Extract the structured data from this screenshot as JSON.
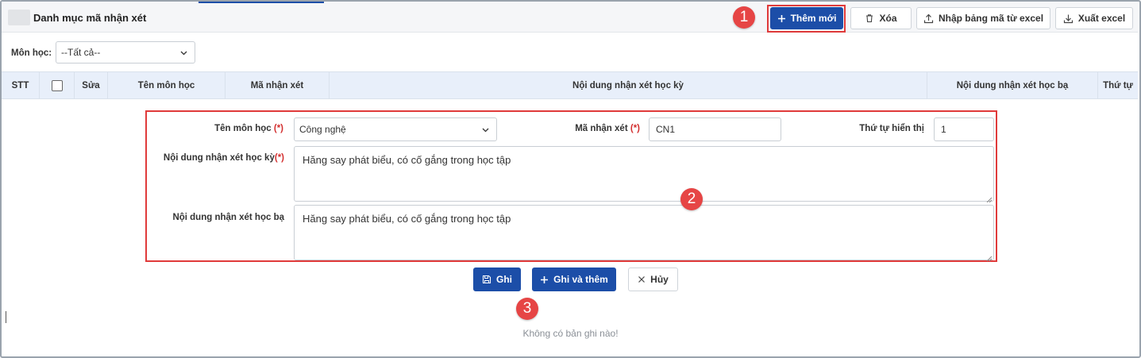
{
  "header": {
    "title": "Danh mục mã nhận xét",
    "buttons": {
      "add": "Thêm mới",
      "delete": "Xóa",
      "import": "Nhập bảng mã từ excel",
      "export": "Xuất excel"
    }
  },
  "filter": {
    "label": "Môn học:",
    "value": "--Tất cả--"
  },
  "table": {
    "columns": [
      "STT",
      "",
      "Sửa",
      "Tên môn học",
      "Mã nhận xét",
      "Nội dung nhận xét học kỳ",
      "Nội dung nhận xét học bạ",
      "Thứ tự"
    ],
    "empty_message": "Không có bản ghi nào!"
  },
  "form": {
    "subject_label": "Tên môn học",
    "subject_value": "Công nghệ",
    "code_label": "Mã nhận xét",
    "code_value": "CN1",
    "order_label": "Thứ tự hiển thị",
    "order_value": "1",
    "semester_label": "Nội dung nhận xét học kỳ",
    "semester_value": "Hăng say phát biểu, có cố gắng trong học tập",
    "report_label": "Nội dung nhận xét học bạ",
    "report_value": "Hăng say phát biểu, có cố gắng trong học tập",
    "required_mark": "(*)"
  },
  "actions": {
    "save": "Ghi",
    "save_add": "Ghi và thêm",
    "cancel": "Hủy"
  },
  "callouts": [
    "1",
    "2",
    "3"
  ],
  "colors": {
    "primary": "#1c4ea8",
    "callout": "#e64545",
    "highlight_border": "#e03a3a",
    "table_header": "#e8effa"
  },
  "icons": {
    "add": "plus-icon",
    "delete": "trash-icon",
    "import": "upload-icon",
    "export": "download-icon",
    "save": "floppy-icon",
    "cancel": "close-icon",
    "dropdown": "chevron-down-icon"
  }
}
